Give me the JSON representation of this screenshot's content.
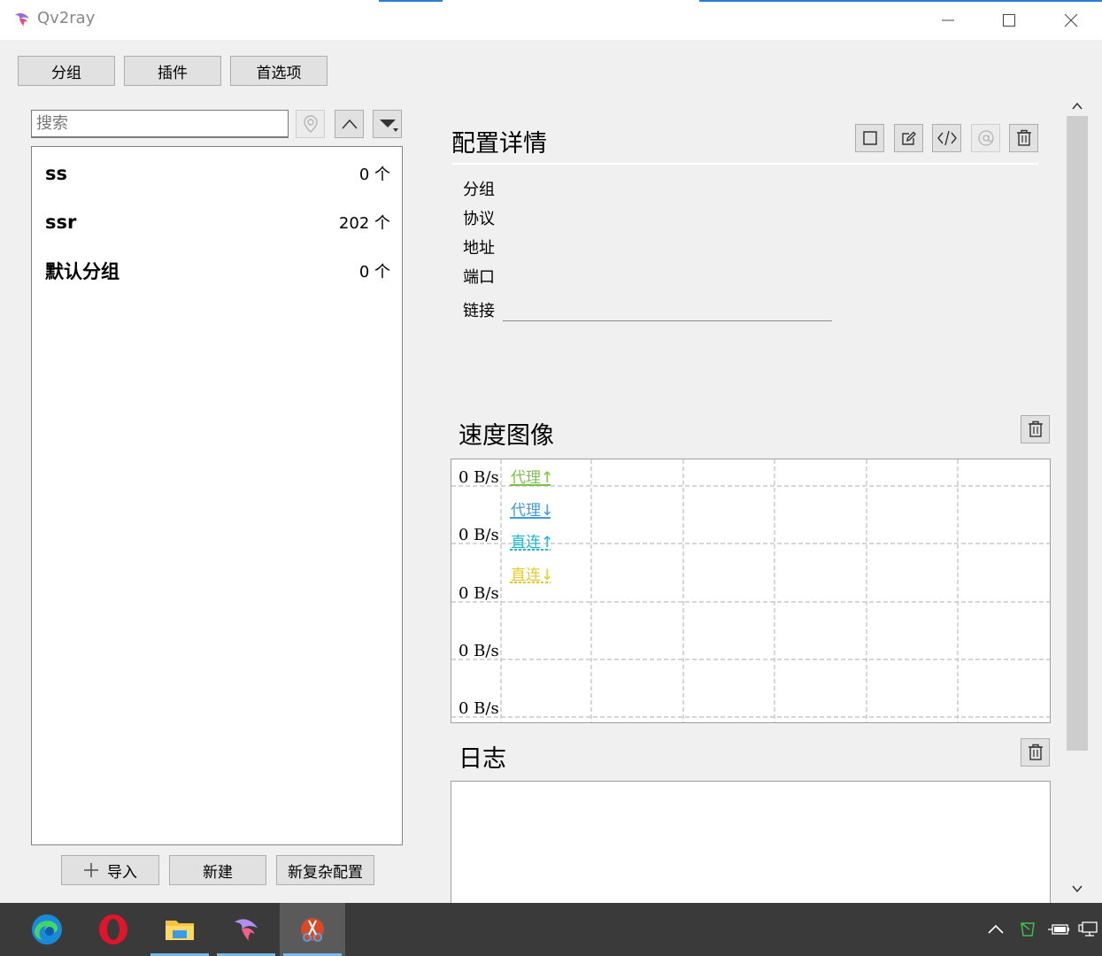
{
  "window": {
    "title": "Qv2ray"
  },
  "toolbar": {
    "group_label": "分组",
    "plugin_label": "插件",
    "pref_label": "首选项"
  },
  "search": {
    "placeholder": "搜索"
  },
  "groups": [
    {
      "name": "ss",
      "count": "0 个"
    },
    {
      "name": "ssr",
      "count": "202 个"
    },
    {
      "name": "默认分组",
      "count": "0 个"
    }
  ],
  "bottom_buttons": {
    "import_label": "导入",
    "new_label": "新建",
    "complex_label": "新复杂配置"
  },
  "details": {
    "title": "配置详情",
    "labels": {
      "group": "分组",
      "protocol": "协议",
      "address": "地址",
      "port": "端口",
      "link": "链接"
    }
  },
  "speed": {
    "title": "速度图像",
    "y_labels": [
      "0 B/s",
      "0 B/s",
      "0 B/s",
      "0 B/s",
      "0 B/s"
    ],
    "legend": [
      {
        "label": "代理↑",
        "color": "#7cc242",
        "style": "solid"
      },
      {
        "label": "代理↓",
        "color": "#3b9be0",
        "style": "solid"
      },
      {
        "label": "直连↑",
        "color": "#19b8d2",
        "style": "dashed"
      },
      {
        "label": "直连↓",
        "color": "#e0cc2a",
        "style": "dashed"
      }
    ]
  },
  "log": {
    "title": "日志"
  },
  "colors": {
    "window_bg": "#f0f0f0",
    "taskbar": "#3a3a3a",
    "accent": "#2b7cd3"
  }
}
